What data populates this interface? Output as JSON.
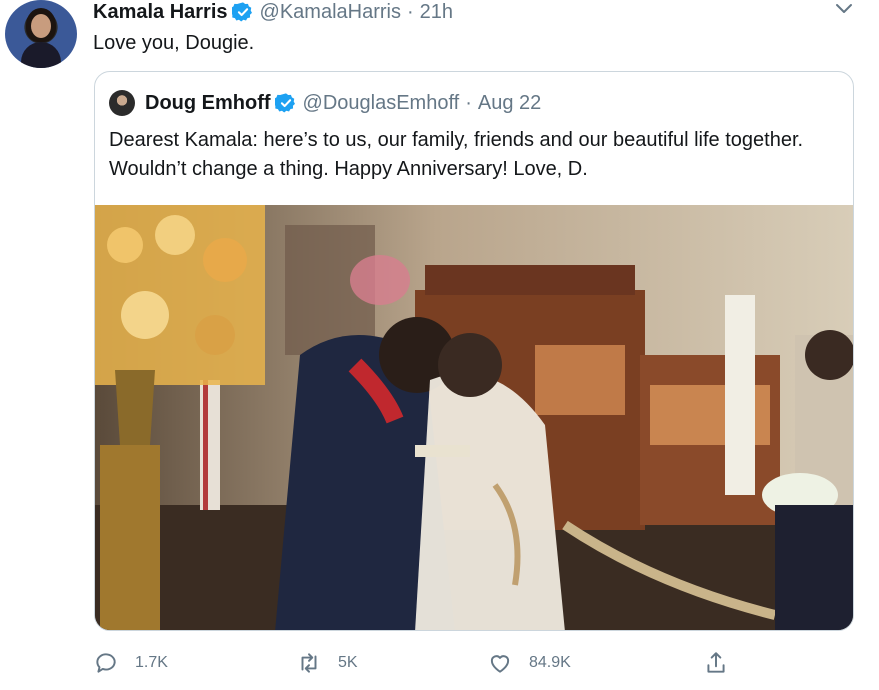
{
  "tweet": {
    "display_name": "Kamala Harris",
    "handle": "@KamalaHarris",
    "separator": "·",
    "time": "21h",
    "text": "Love you, Dougie."
  },
  "quoted": {
    "display_name": "Doug Emhoff",
    "handle": "@DouglasEmhoff",
    "separator": "·",
    "time": "Aug 22",
    "text": "Dearest Kamala: here’s to us, our family, friends and our beautiful life together. Wouldn’t change a thing. Happy Anniversary! Love, D."
  },
  "actions": {
    "reply_count": "1.7K",
    "retweet_count": "5K",
    "like_count": "84.9K"
  },
  "icons": {
    "verified": "verified-badge-icon",
    "menu": "chevron-down-icon",
    "reply": "reply-icon",
    "retweet": "retweet-icon",
    "like": "heart-icon",
    "share": "share-icon"
  },
  "colors": {
    "verified": "#1da1f2",
    "secondary_text": "#657786",
    "border": "#ccd6dd"
  }
}
